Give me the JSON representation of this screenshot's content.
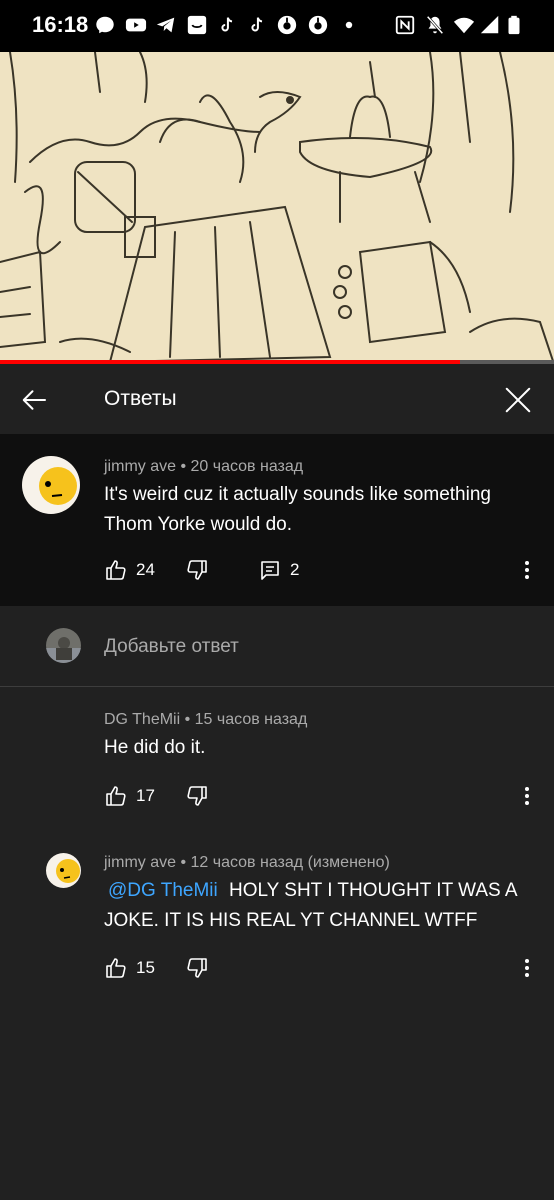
{
  "status_bar": {
    "time": "16:18",
    "icons": [
      "messenger-icon",
      "youtube-icon",
      "telegram-icon",
      "smile-app-icon",
      "tiktok-icon",
      "tiktok-icon",
      "circle-app-icon",
      "circle-app-icon",
      "dot-icon",
      "nfc-icon",
      "mute-icon",
      "wifi-icon",
      "signal-icon",
      "battery-icon"
    ]
  },
  "video": {
    "progress": 0.83,
    "accent": "#ff0000"
  },
  "header": {
    "title": "Ответы",
    "back_icon": "arrow-left-icon",
    "close_icon": "close-icon"
  },
  "parent_comment": {
    "author_meta": "jimmy ave • 20 часов назад",
    "text": "It's weird cuz it actually sounds like something Thom Yorke would do.",
    "likes": "24",
    "replies": "2"
  },
  "add_reply": {
    "placeholder": "Добавьте ответ"
  },
  "replies": [
    {
      "author_meta": "DG TheMii • 15 часов назад",
      "text": "He did do it.",
      "likes": "17"
    },
    {
      "author_meta": "jimmy ave • 12 часов назад (изменено)",
      "mention": "@DG TheMii",
      "text": "HOLY SHT I THOUGHT IT WAS A JOKE. IT IS HIS REAL YT CHANNEL WTFF",
      "likes": "15"
    }
  ],
  "colors": {
    "background": "#212121",
    "parent_background": "#0f0f0f",
    "mention": "#3ea6ff",
    "meta_text": "#aaaaaa"
  }
}
